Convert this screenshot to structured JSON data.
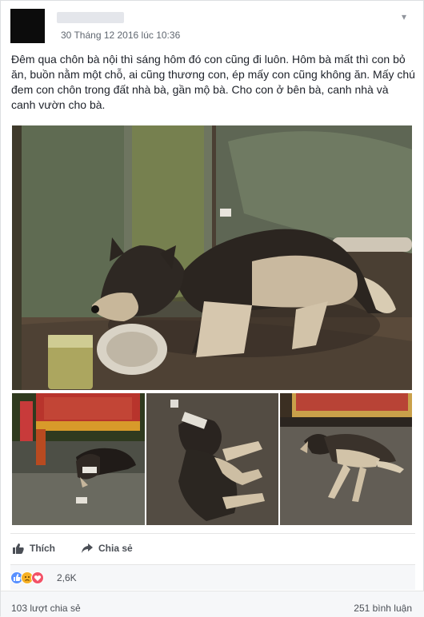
{
  "post": {
    "timestamp": "30 Tháng 12 2016 lúc 10:36",
    "text": "Đêm qua chôn bà nội thì sáng hôm đó con cũng đi luôn. Hôm bà mất thì con bỏ ăn, buồn nằm một chỗ, ai cũng thương con, ép mấy con cũng không ăn. Mấy chú đem con chôn trong đất nhà bà, gần mộ bà. Cho con ở bên bà, canh nhà và canh vườn cho bà."
  },
  "actions": {
    "like_label": "Thích",
    "share_label": "Chia sẻ"
  },
  "reactions": {
    "icons": [
      "like-icon",
      "sad-icon",
      "love-icon"
    ],
    "count": "2,6K"
  },
  "footer": {
    "shares": "103 lượt chia sẻ",
    "comments": "251 bình luận"
  },
  "colors": {
    "like": "#5890ff",
    "sad": "#f7b125",
    "love": "#f25268"
  }
}
